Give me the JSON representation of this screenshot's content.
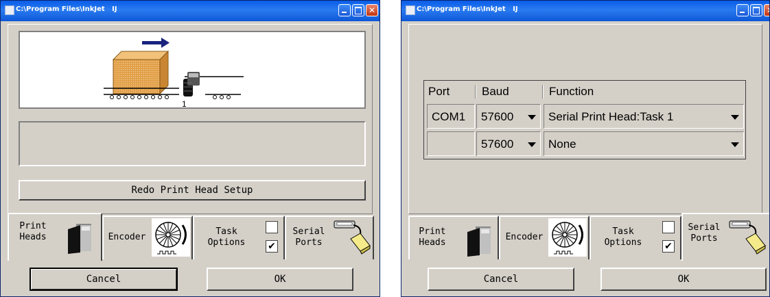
{
  "windows": [
    {
      "title": "C:\\Program Files\\InkJet   IJ",
      "redo_label": "Redo Print Head Setup",
      "conveyor_head_number": "1",
      "tabs": [
        {
          "line1": "Print",
          "line2": "Heads"
        },
        {
          "line1": "Encoder"
        },
        {
          "line1": "Task",
          "line2": "Options"
        },
        {
          "line1": "Serial",
          "line2": "Ports"
        }
      ],
      "selected_tab": "Print Heads",
      "cancel_label": "Cancel",
      "ok_label": "OK"
    },
    {
      "title": "C:\\Program Files\\InkJet   IJ",
      "table": {
        "headers": [
          "Port",
          "Baud",
          "Function"
        ],
        "rows": [
          {
            "port": "COM1",
            "baud": "57600",
            "function": "Serial Print Head:Task 1"
          },
          {
            "port": "",
            "baud": "57600",
            "function": "None"
          }
        ]
      },
      "tabs": [
        {
          "line1": "Print",
          "line2": "Heads"
        },
        {
          "line1": "Encoder"
        },
        {
          "line1": "Task",
          "line2": "Options"
        },
        {
          "line1": "Serial",
          "line2": "Ports"
        }
      ],
      "selected_tab": "Serial Ports",
      "cancel_label": "Cancel",
      "ok_label": "OK"
    }
  ],
  "colors": {
    "titlebar": "#0a5de8",
    "face": "#d4d0c8",
    "arrow": "#1a237e",
    "box": "#e29a3c"
  },
  "icons": [
    "print-head-icon",
    "encoder-wheel-icon",
    "checkbox-icon",
    "serial-cable-icon",
    "minimize-icon",
    "maximize-icon",
    "close-icon"
  ]
}
